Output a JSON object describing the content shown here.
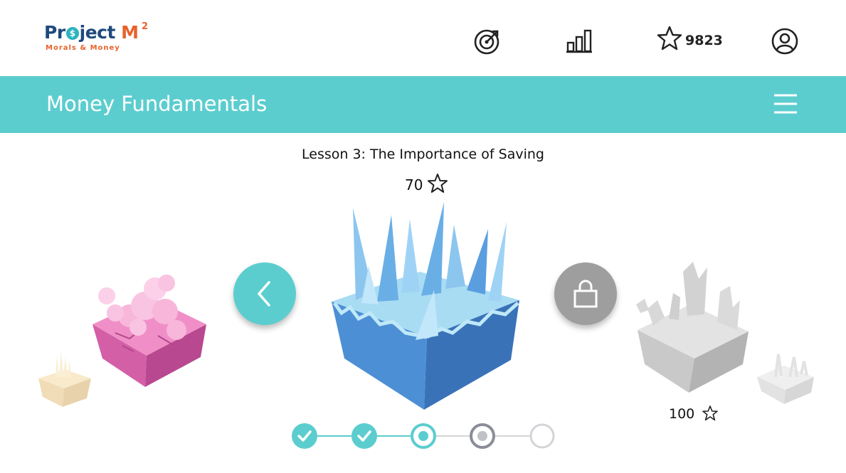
{
  "app": {
    "logo_text": "Project M",
    "logo_superscript": "2",
    "logo_tagline": "Morals & Money"
  },
  "header": {
    "star_points": "9823",
    "icons": [
      "goal-target-icon",
      "stats-bar-chart-icon",
      "star-icon",
      "profile-icon"
    ]
  },
  "course": {
    "title": "Money Fundamentals",
    "menu_icon": "hamburger-menu-icon"
  },
  "lesson": {
    "title": "Lesson 3: The Importance of Saving",
    "points": "70"
  },
  "next_lesson": {
    "points": "100",
    "locked": true
  },
  "progress": {
    "steps": [
      "completed",
      "completed",
      "current",
      "locked",
      "locked"
    ]
  },
  "colors": {
    "accent": "#5ccdcf",
    "brand_blue": "#1f4a7c",
    "brand_orange": "#e8622b",
    "locked_gray": "#9e9e9e"
  }
}
